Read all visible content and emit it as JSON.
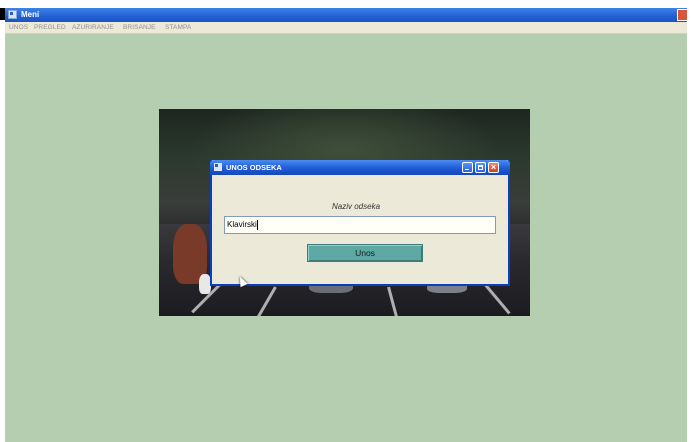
{
  "app": {
    "title": "Meni",
    "menu": [
      "UNOS",
      "PREGLED",
      "AZURIRANJE",
      "BRISANJE",
      "STAMPA"
    ]
  },
  "dialog": {
    "title": "UNOS ODSEKA",
    "label": "Naziv odseka",
    "input_value": "Klavirski",
    "submit_label": "Unos"
  },
  "colors": {
    "desktop": "#b5ceaf",
    "titlebar": "#2160d4",
    "button": "#5ea9a3"
  },
  "icons": {
    "app": "window-app-icon",
    "minimize": "minimize-icon",
    "maximize": "maximize-icon",
    "close": "close-icon"
  }
}
